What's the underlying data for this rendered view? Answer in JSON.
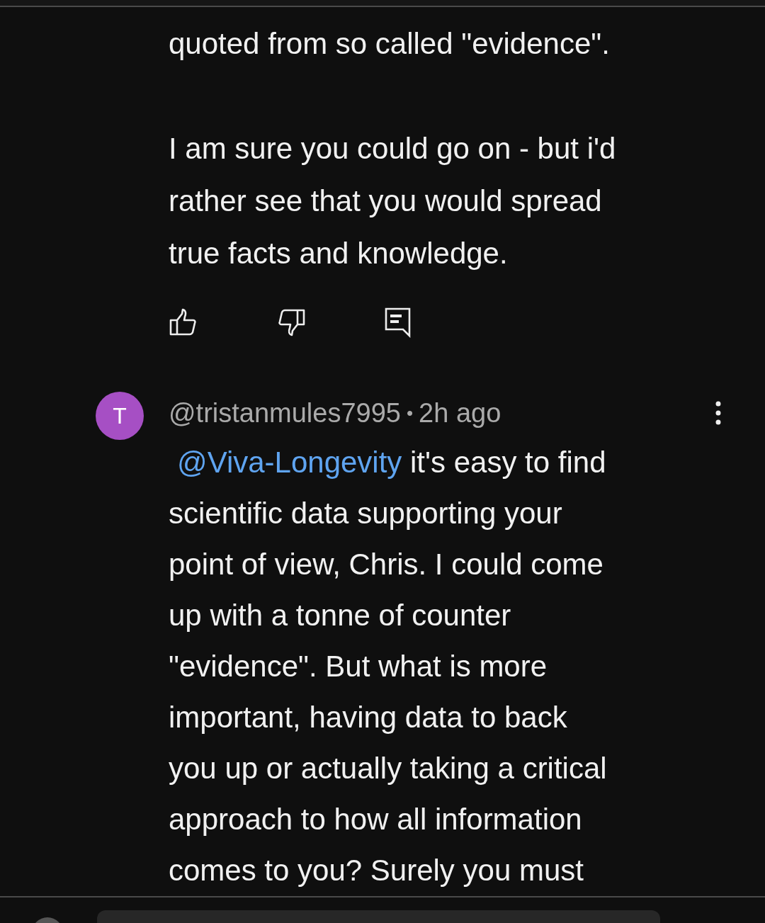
{
  "reply_continuation": {
    "paragraphs": [
      [
        "quoted from so called \"evidence\"."
      ],
      [
        "I am sure you could go on - but i'd",
        "rather see that you would spread",
        "true facts and knowledge."
      ]
    ]
  },
  "comment": {
    "avatar_letter": "T",
    "author": "@tristanmules7995",
    "separator": "•",
    "time": "2h ago",
    "mention": "@Viva-Longevity",
    "lines": [
      " it's easy to find",
      "scientific data supporting your",
      "point of view, Chris. I could come",
      "up with a tonne of counter",
      "\"evidence\". But what is more",
      "important, having data to back",
      "you up or actually taking a critical",
      "approach to how all information",
      "comes to you? Surely you must"
    ]
  }
}
